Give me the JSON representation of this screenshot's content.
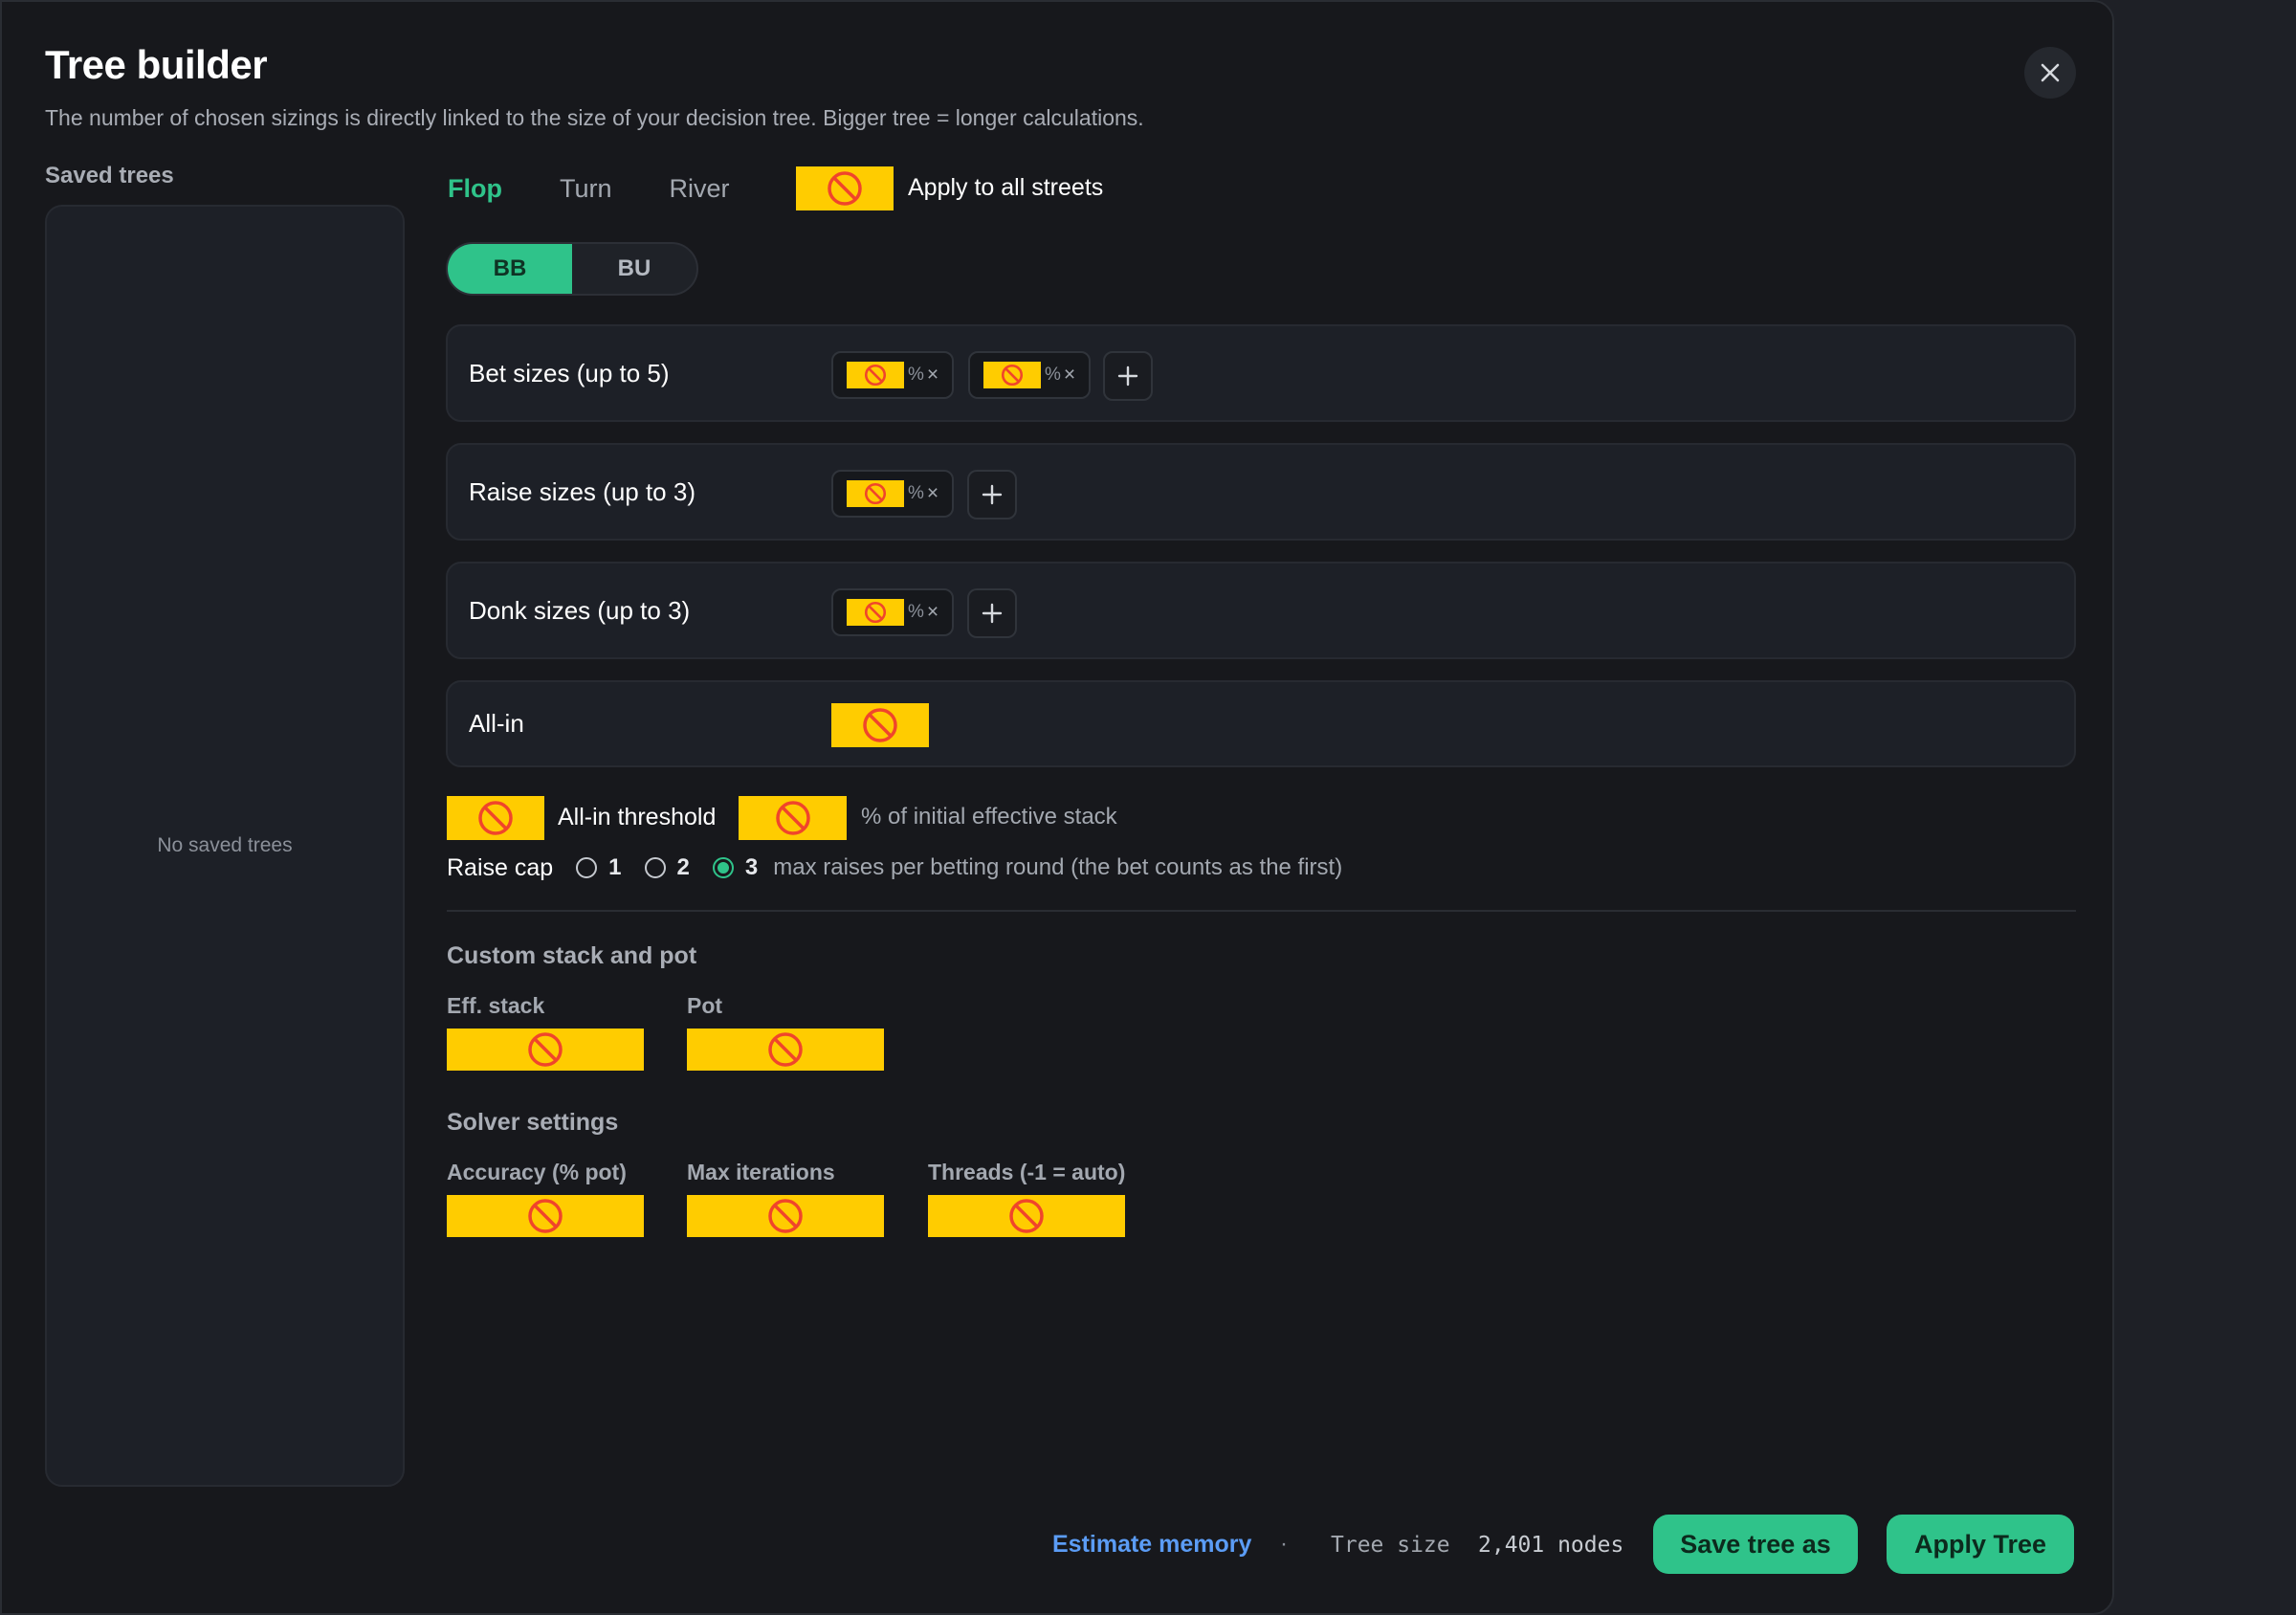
{
  "dialog": {
    "title": "Tree builder",
    "subtitle": "The number of chosen sizings is directly linked to the size of your decision tree. Bigger tree = longer calculations."
  },
  "saved_trees": {
    "label": "Saved trees",
    "empty_text": "No saved trees"
  },
  "streets": {
    "tabs": [
      "Flop",
      "Turn",
      "River"
    ],
    "active": "Flop",
    "apply_all_label": "Apply to all streets"
  },
  "positions": {
    "options": [
      "BB",
      "BU"
    ],
    "active": "BB"
  },
  "sizing_rows": {
    "bet": {
      "label": "Bet sizes (up to 5)",
      "chip_count": 2
    },
    "raise": {
      "label": "Raise sizes (up to 3)",
      "chip_count": 1
    },
    "donk": {
      "label": "Donk sizes (up to 3)",
      "chip_count": 1
    },
    "allin": {
      "label": "All-in"
    },
    "chip_suffix": "%",
    "chip_remove": "×",
    "add_symbol": "+"
  },
  "threshold": {
    "label": "All-in threshold",
    "suffix": "% of initial effective stack"
  },
  "raise_cap": {
    "label": "Raise cap",
    "options": [
      "1",
      "2",
      "3"
    ],
    "selected": "3",
    "suffix": "max raises per betting round (the bet counts as the first)"
  },
  "custom_stack": {
    "title": "Custom stack and pot",
    "eff_stack_label": "Eff. stack",
    "pot_label": "Pot"
  },
  "solver": {
    "title": "Solver settings",
    "accuracy_label": "Accuracy (% pot)",
    "iterations_label": "Max iterations",
    "threads_label": "Threads (-1 = auto)"
  },
  "footer": {
    "estimate_label": "Estimate memory",
    "separator": "·",
    "tree_size_label": "Tree size",
    "tree_size_value": "2,401 nodes",
    "save_label": "Save tree as",
    "apply_label": "Apply Tree"
  },
  "colors": {
    "accent": "#2fc38a",
    "link": "#5b9cf5",
    "blocked_fill": "#ffcc00",
    "blocked_icon": "#f0452b",
    "background": "#17181c"
  },
  "icons": {
    "blocked": "no-entry-icon",
    "close": "close-icon",
    "add": "plus-icon"
  }
}
